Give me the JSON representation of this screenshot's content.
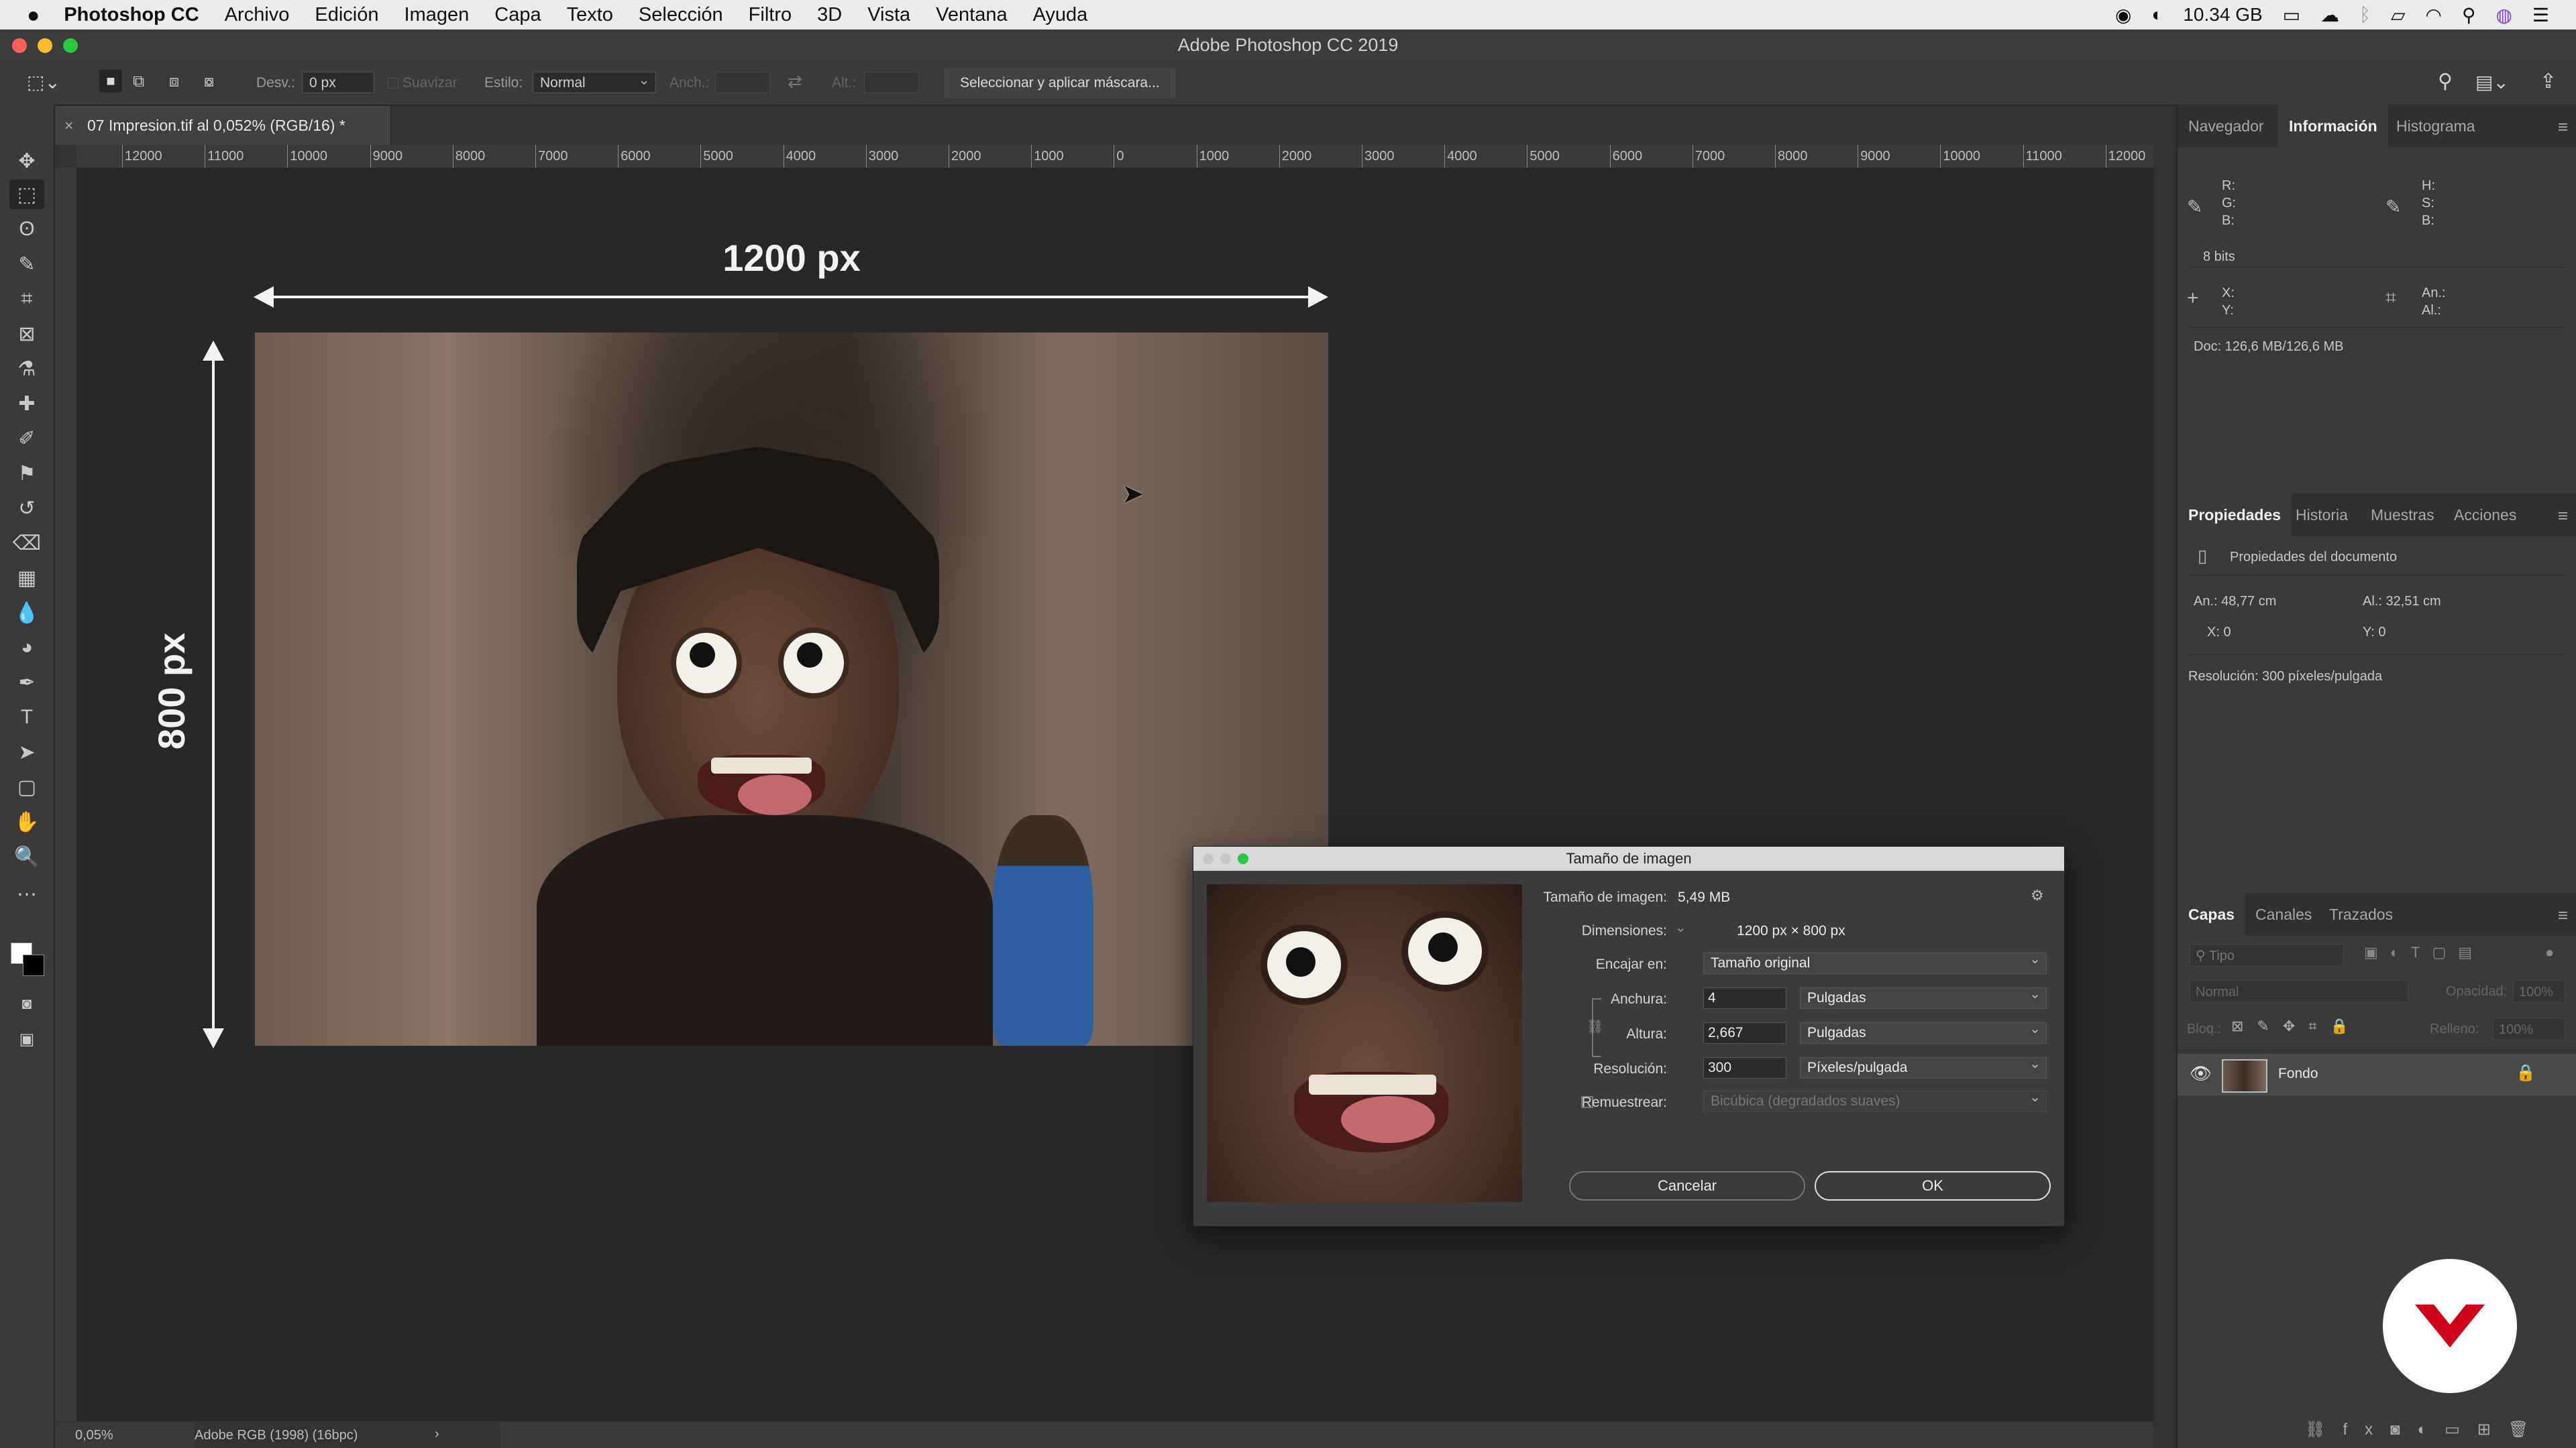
{
  "menubar": {
    "apple": "",
    "app": "Photoshop CC",
    "items": [
      "Archivo",
      "Edición",
      "Imagen",
      "Capa",
      "Texto",
      "Selección",
      "Filtro",
      "3D",
      "Vista",
      "Ventana",
      "Ayuda"
    ],
    "storage": "10.34 GB"
  },
  "window": {
    "title": "Adobe Photoshop CC 2019"
  },
  "options": {
    "desv_label": "Desv.:",
    "desv_value": "0 px",
    "suavizar": "Suavizar",
    "estilo_label": "Estilo:",
    "estilo_value": "Normal",
    "anch_label": "Anch.:",
    "alt_label": "Alt.:",
    "mask_button": "Seleccionar y aplicar máscara..."
  },
  "document": {
    "tab_title": "07 Impresion.tif al 0,052% (RGB/16) *"
  },
  "ruler": {
    "h_ticks": [
      "12000",
      "11000",
      "10000",
      "9000",
      "8000",
      "7000",
      "6000",
      "5000",
      "4000",
      "3000",
      "2000",
      "1000",
      "0",
      "1000",
      "2000",
      "3000",
      "4000",
      "5000",
      "6000",
      "7000",
      "8000",
      "9000",
      "10000",
      "11000",
      "12000"
    ]
  },
  "annotations": {
    "width": "1200 px",
    "height": "800 px"
  },
  "status": {
    "zoom": "0,05%",
    "profile": "Adobe RGB (1998) (16bpc)"
  },
  "info_panel": {
    "tabs": [
      "Navegador",
      "Información",
      "Histograma"
    ],
    "r": "R:",
    "g": "G:",
    "b": "B:",
    "h": "H:",
    "s": "S:",
    "bb": "B:",
    "bits": "8 bits",
    "x": "X:",
    "y": "Y:",
    "an": "An.:",
    "al": "Al.:",
    "doc": "Doc: 126,6 MB/126,6 MB"
  },
  "properties_panel": {
    "tabs": [
      "Propiedades",
      "Historia",
      "Muestras",
      "Acciones"
    ],
    "title": "Propiedades del documento",
    "an": "An.: 48,77 cm",
    "al": "Al.: 32,51 cm",
    "x": "X: 0",
    "y": "Y: 0",
    "resolution": "Resolución: 300 píxeles/pulgada"
  },
  "layers_panel": {
    "tabs": [
      "Capas",
      "Canales",
      "Trazados"
    ],
    "search": "Tipo",
    "blend": "Normal",
    "opacity_label": "Opacidad:",
    "opacity_value": "100%",
    "lock_label": "Bloq.:",
    "fill_label": "Relleno:",
    "fill_value": "100%",
    "layers": [
      {
        "name": "Fondo"
      }
    ]
  },
  "dialog": {
    "title": "Tamaño de imagen",
    "size_label": "Tamaño de imagen:",
    "size_value": "5,49 MB",
    "dims_label": "Dimensiones:",
    "dims_value": "1200 px × 800 px",
    "fit_label": "Encajar en:",
    "fit_value": "Tamaño original",
    "width_label": "Anchura:",
    "width_value": "4",
    "width_unit": "Pulgadas",
    "height_label": "Altura:",
    "height_value": "2,667",
    "height_unit": "Pulgadas",
    "res_label": "Resolución:",
    "res_value": "300",
    "res_unit": "Píxeles/pulgada",
    "resample_label": "Remuestrear:",
    "resample_value": "Bicúbica (degradados suaves)",
    "cancel": "Cancelar",
    "ok": "OK"
  },
  "colors": {
    "brand_red": "#d0011b",
    "traffic_red": "#fe5f57",
    "traffic_yellow": "#febc2e",
    "traffic_green": "#28c840"
  }
}
